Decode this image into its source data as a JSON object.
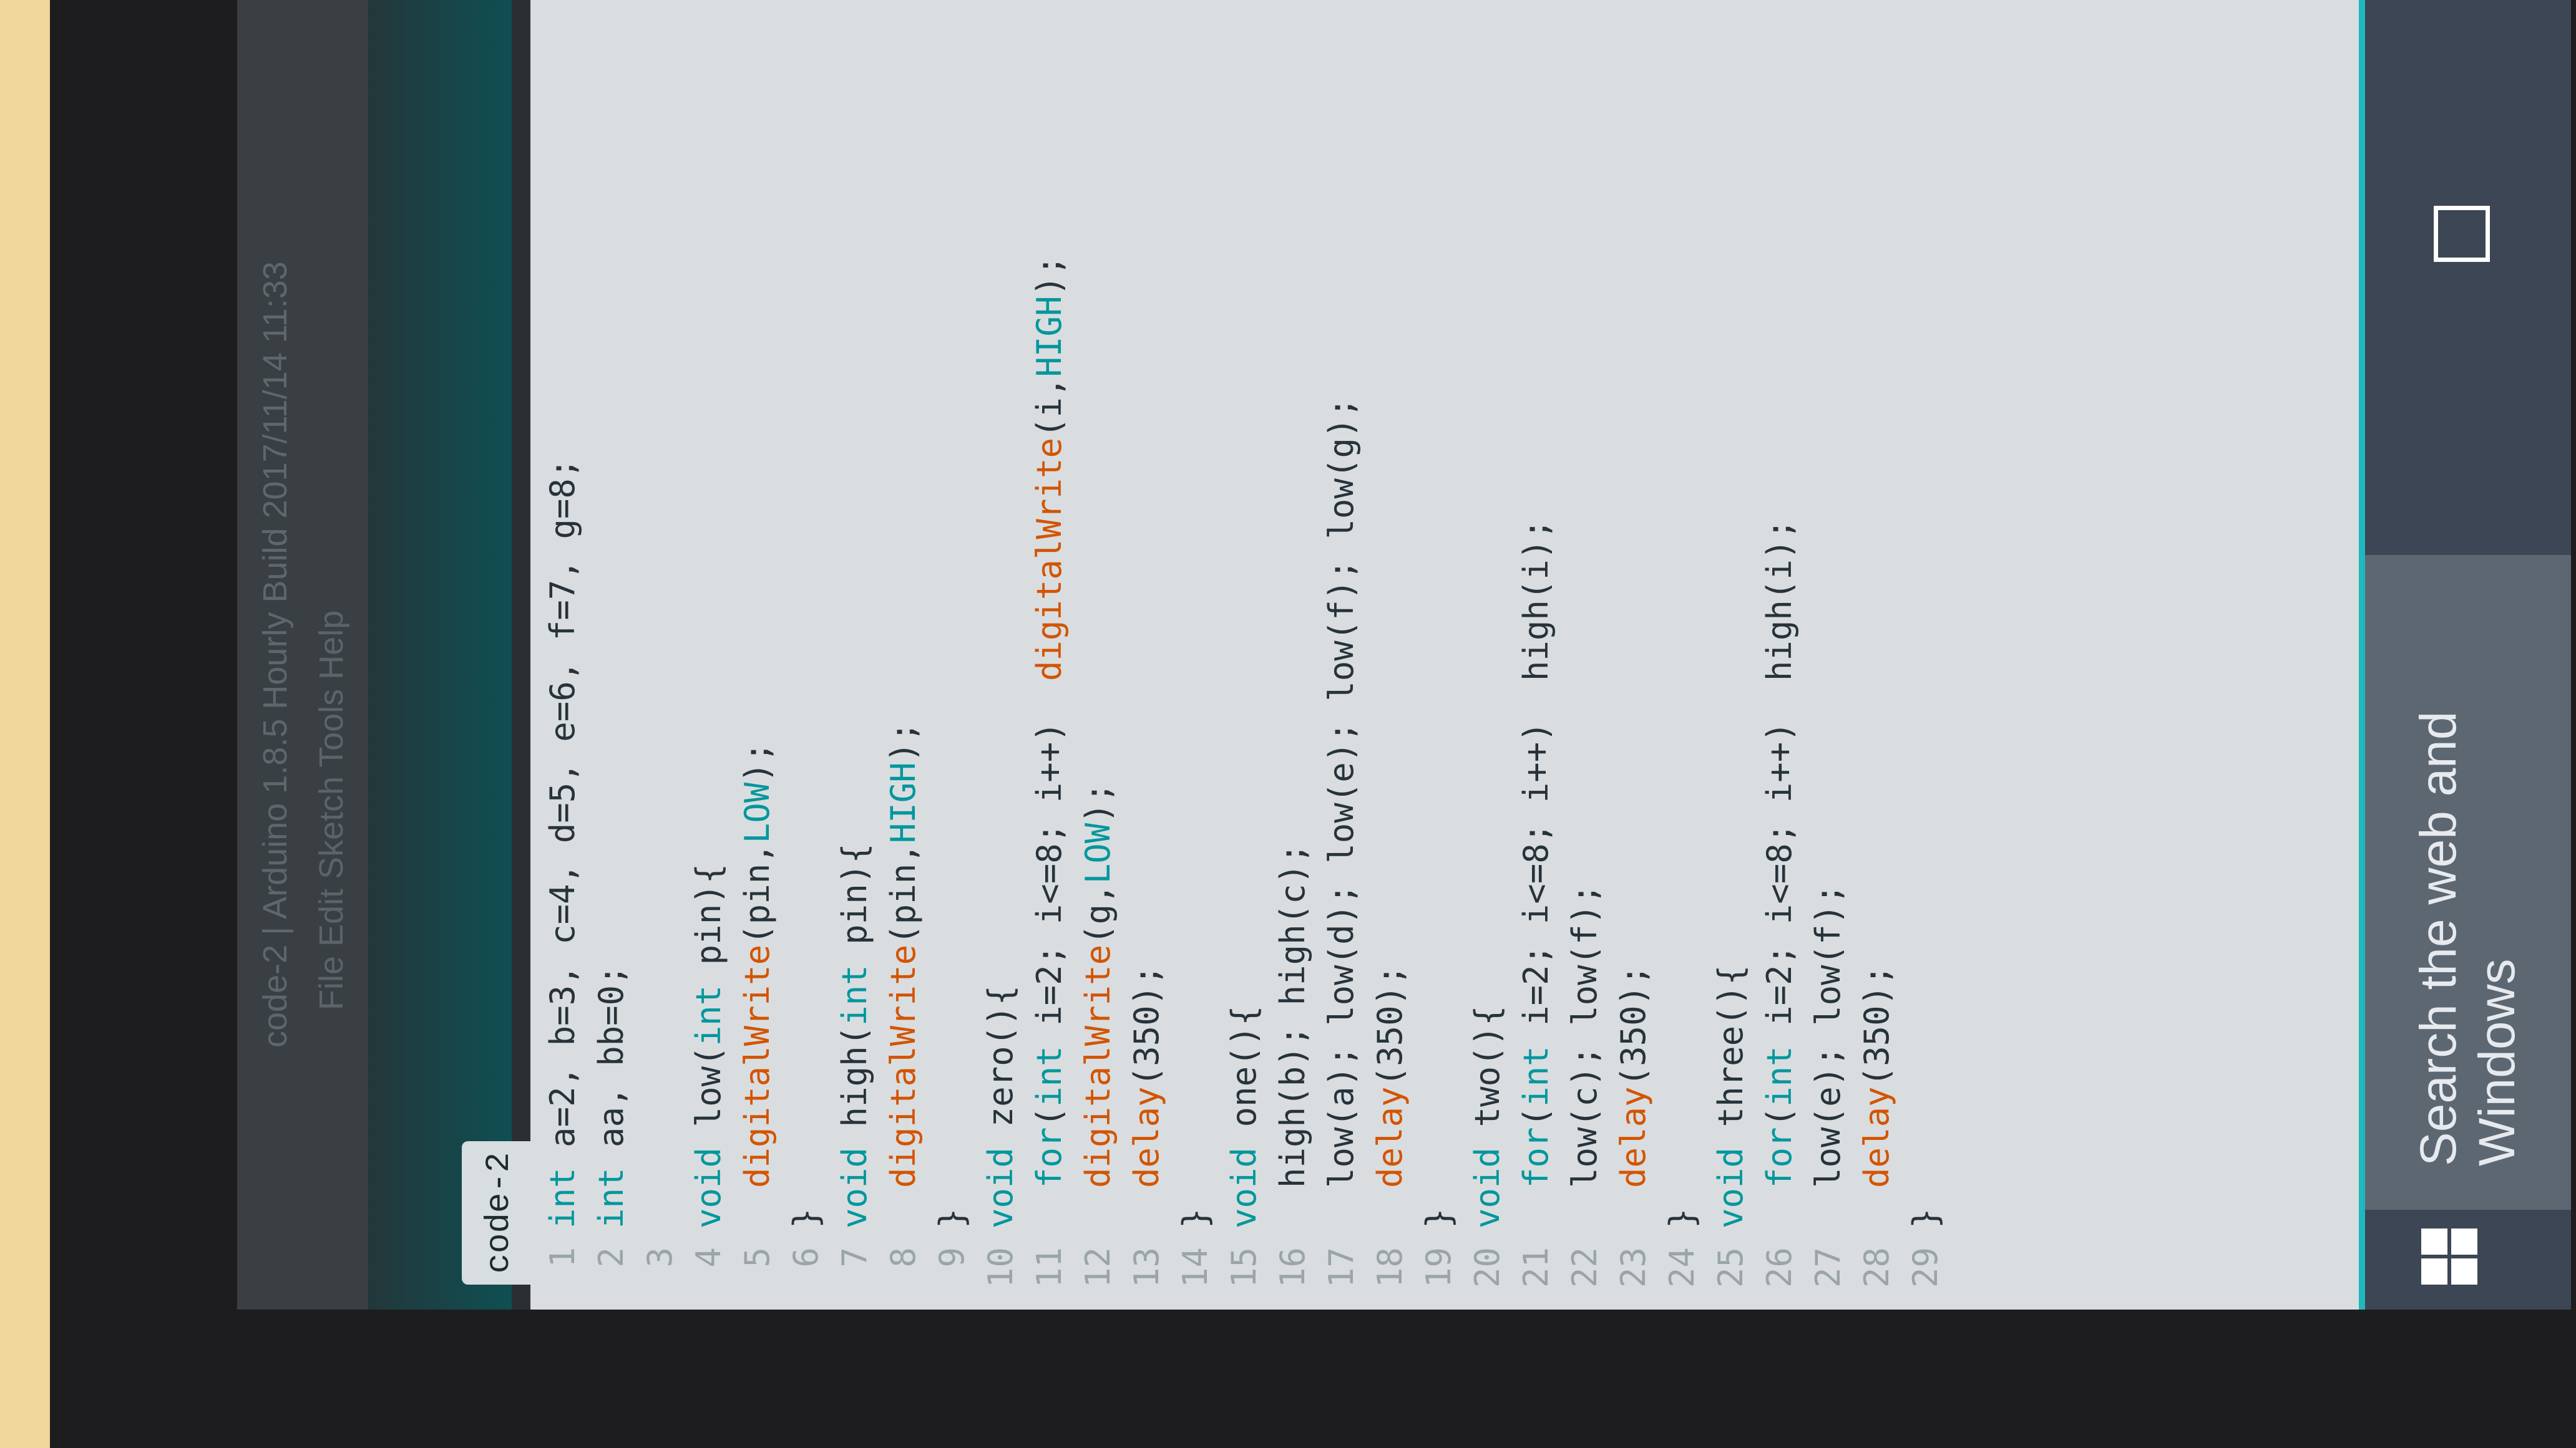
{
  "window": {
    "title": "code-2 | Arduino 1.8.5 Hourly Build 2017/11/14 11:33",
    "menu": "File  Edit  Sketch  Tools  Help"
  },
  "editor": {
    "tab_label": "code-2",
    "lines": [
      {
        "n": "1",
        "t": "int a=2, b=3, c=4, d=5, e=6, f=7, g=8;"
      },
      {
        "n": "2",
        "t": "int aa, bb=0;"
      },
      {
        "n": "3",
        "t": ""
      },
      {
        "n": "4",
        "t": "void low(int pin){"
      },
      {
        "n": "5",
        "t": "  digitalWrite(pin,LOW);"
      },
      {
        "n": "6",
        "t": "}"
      },
      {
        "n": "7",
        "t": "void high(int pin){"
      },
      {
        "n": "8",
        "t": "  digitalWrite(pin,HIGH);"
      },
      {
        "n": "9",
        "t": "}"
      },
      {
        "n": "10",
        "t": "void zero(){"
      },
      {
        "n": "11",
        "t": "  for(int i=2; i<=8; i++)  digitalWrite(i,HIGH);"
      },
      {
        "n": "12",
        "t": "  digitalWrite(g,LOW);"
      },
      {
        "n": "13",
        "t": "  delay(350);"
      },
      {
        "n": "14",
        "t": "}"
      },
      {
        "n": "15",
        "t": "void one(){"
      },
      {
        "n": "16",
        "t": "  high(b); high(c);"
      },
      {
        "n": "17",
        "t": "  low(a); low(d); low(e); low(f); low(g);"
      },
      {
        "n": "18",
        "t": "  delay(350);"
      },
      {
        "n": "19",
        "t": "}"
      },
      {
        "n": "20",
        "t": "void two(){"
      },
      {
        "n": "21",
        "t": "  for(int i=2; i<=8; i++)  high(i);"
      },
      {
        "n": "22",
        "t": "  low(c); low(f);"
      },
      {
        "n": "23",
        "t": "  delay(350);"
      },
      {
        "n": "24",
        "t": "}"
      },
      {
        "n": "25",
        "t": "void three(){"
      },
      {
        "n": "26",
        "t": "  for(int i=2; i<=8; i++)  high(i);"
      },
      {
        "n": "27",
        "t": "  low(e); low(f);"
      },
      {
        "n": "28",
        "t": "  delay(350);"
      },
      {
        "n": "29",
        "t": "}"
      }
    ]
  },
  "taskbar": {
    "search_placeholder": "Search the web and Windows"
  },
  "colors": {
    "keyword": "#00979c",
    "function": "#d35400",
    "editor_bg": "#d9dde0",
    "toolbar": "#006468",
    "status_bar": "#17a4aa",
    "taskbar": "#3c4654"
  },
  "icons": [
    "windows-start-icon",
    "task-view-icon"
  ]
}
